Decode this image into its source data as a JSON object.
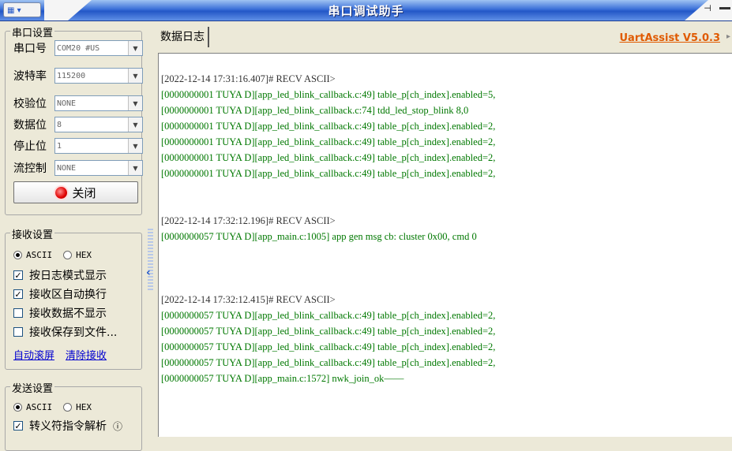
{
  "window": {
    "title": "串口调试助手",
    "sysmenu_glyph": "▾"
  },
  "serial": {
    "legend": "串口设置",
    "fields": [
      {
        "label": "串口号",
        "value": "COM20 #US"
      },
      {
        "label": "波特率",
        "value": "115200"
      },
      {
        "label": "校验位",
        "value": "NONE"
      },
      {
        "label": "数据位",
        "value": "8"
      },
      {
        "label": "停止位",
        "value": "1"
      },
      {
        "label": "流控制",
        "value": "NONE"
      }
    ],
    "close_button": "关闭"
  },
  "receive": {
    "legend": "接收设置",
    "radio_ascii": "ASCII",
    "radio_hex": "HEX",
    "selected": "ASCII",
    "checks": [
      {
        "label": "按日志模式显示",
        "checked": true
      },
      {
        "label": "接收区自动换行",
        "checked": true
      },
      {
        "label": "接收数据不显示",
        "checked": false
      },
      {
        "label": "接收保存到文件...",
        "checked": false
      }
    ],
    "link_autoscroll": "自动滚屏",
    "link_clear": "清除接收"
  },
  "send": {
    "legend": "发送设置",
    "radio_ascii": "ASCII",
    "radio_hex": "HEX",
    "selected": "ASCII",
    "check_escape": "转义符指令解析",
    "info_glyph": "ⓘ"
  },
  "main": {
    "tab_label": "数据日志",
    "brand": "UartAssist V5.0.3"
  },
  "log": [
    {
      "kind": "hdr",
      "text": "[2022-12-14 17:31:16.407]# RECV ASCII>"
    },
    {
      "kind": "dat",
      "text": "[0000000001 TUYA D][app_led_blink_callback.c:49] table_p[ch_index].enabled=5,"
    },
    {
      "kind": "dat",
      "text": "[0000000001 TUYA D][app_led_blink_callback.c:74] tdd_led_stop_blink 8,0"
    },
    {
      "kind": "dat",
      "text": "[0000000001 TUYA D][app_led_blink_callback.c:49] table_p[ch_index].enabled=2,"
    },
    {
      "kind": "dat",
      "text": "[0000000001 TUYA D][app_led_blink_callback.c:49] table_p[ch_index].enabled=2,"
    },
    {
      "kind": "dat",
      "text": "[0000000001 TUYA D][app_led_blink_callback.c:49] table_p[ch_index].enabled=2,"
    },
    {
      "kind": "dat",
      "text": "[0000000001 TUYA D][app_led_blink_callback.c:49] table_p[ch_index].enabled=2,"
    },
    {
      "kind": "hdr",
      "text": "[2022-12-14 17:32:12.196]# RECV ASCII>"
    },
    {
      "kind": "dat",
      "text": "[0000000057 TUYA D][app_main.c:1005] app gen msg cb: cluster 0x00, cmd 0"
    },
    {
      "kind": "hdr",
      "text": "[2022-12-14 17:32:12.415]# RECV ASCII>"
    },
    {
      "kind": "dat",
      "text": "[0000000057 TUYA D][app_led_blink_callback.c:49] table_p[ch_index].enabled=2,"
    },
    {
      "kind": "dat",
      "text": "[0000000057 TUYA D][app_led_blink_callback.c:49] table_p[ch_index].enabled=2,"
    },
    {
      "kind": "dat",
      "text": "[0000000057 TUYA D][app_led_blink_callback.c:49] table_p[ch_index].enabled=2,"
    },
    {
      "kind": "dat",
      "text": "[0000000057 TUYA D][app_led_blink_callback.c:49] table_p[ch_index].enabled=2,"
    },
    {
      "kind": "dat",
      "text": "[0000000057 TUYA D][app_main.c:1572] nwk_join_ok——"
    }
  ]
}
